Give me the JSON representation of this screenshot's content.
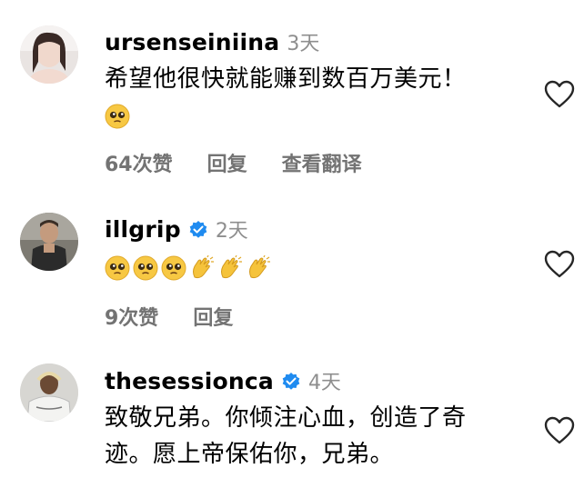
{
  "comments": [
    {
      "username": "ursenseiniina",
      "verified": false,
      "time": "3天",
      "text": "希望他很快就能赚到数百万美元！",
      "emojis": [
        "pleading-face-emoji"
      ],
      "likes": "64次赞",
      "reply": "回复",
      "translate": "查看翻译"
    },
    {
      "username": "illgrip",
      "verified": true,
      "time": "2天",
      "text": "",
      "emojis": [
        "pleading-face-emoji",
        "pleading-face-emoji",
        "pleading-face-emoji",
        "clapping-hands-emoji",
        "clapping-hands-emoji",
        "clapping-hands-emoji"
      ],
      "likes": "9次赞",
      "reply": "回复"
    },
    {
      "username": "thesessionca",
      "verified": true,
      "time": "4天",
      "text_line1": "致敬兄弟。你倾注心血，创造了奇",
      "text_line2": "迹。愿上帝保佑你，兄弟。"
    }
  ],
  "colors": {
    "muted": "#8e8e8e",
    "verified": "#1f8bf0",
    "heart_outline": "#262626"
  },
  "icons": {
    "like": "heart-outline-icon",
    "verified": "verified-badge-icon"
  }
}
